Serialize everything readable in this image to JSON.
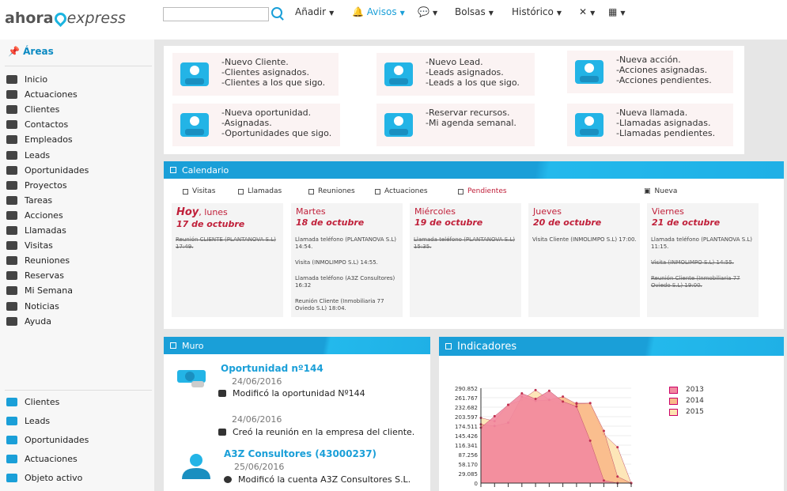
{
  "header": {
    "logo_a": "ahora",
    "logo_e": "express",
    "search_placeholder": "",
    "menu": [
      "Añadir",
      "Avisos",
      "",
      "Bolsas",
      "Histórico",
      "",
      ""
    ]
  },
  "sidebar": {
    "title": "Áreas",
    "items": [
      "Inicio",
      "Actuaciones",
      "Clientes",
      "Contactos",
      "Empleados",
      "Leads",
      "Oportunidades",
      "Proyectos",
      "Tareas",
      "Acciones",
      "Llamadas",
      "Visitas",
      "Reuniones",
      "Reservas",
      "Mi Semana",
      "Noticias",
      "Ayuda"
    ],
    "bottom": [
      "Clientes",
      "Leads",
      "Oportunidades",
      "Actuaciones",
      "Objeto activo"
    ]
  },
  "quick": [
    {
      "text": "-Nuevo Cliente.\n-Clientes asignados.\n-Clientes a los que sigo.",
      "icon": "user-icon"
    },
    {
      "text": "-Nuevo Lead.\n-Leads asignados.\n-Leads a los que sigo.",
      "icon": "lead-icon"
    },
    {
      "text": "-Nueva acción.\n-Acciones asignadas.\n-Acciones pendientes.",
      "icon": "clipboard-icon"
    },
    {
      "text": "-Nueva oportunidad.\n-Asignadas.\n-Oportunidades que sigo.",
      "icon": "money-icon"
    },
    {
      "text": "-Reservar recursos.\n-Mi agenda semanal.",
      "icon": "calendar-icon"
    },
    {
      "text": "-Nueva llamada.\n-Llamadas asignadas.\n-Llamadas pendientes.",
      "icon": "phone-icon"
    }
  ],
  "calendar": {
    "title": "Calendario",
    "filters": [
      "Visitas",
      "Llamadas",
      "Reuniones",
      "Actuaciones",
      "Pendientes"
    ],
    "new_label": "Nueva",
    "days": [
      {
        "name": "Hoy",
        "name2": ", lunes",
        "date": "17 de octubre",
        "events": [
          {
            "t": "Reunión CLIENTE (PLANTANOVA S.L) 17:49.",
            "s": true
          }
        ]
      },
      {
        "name": "Martes",
        "name2": "",
        "date": "18 de octubre",
        "events": [
          {
            "t": "Llamada teléfono (PLANTANOVA S.L) 14:54.",
            "s": false
          },
          {
            "t": "Visita (INMOLIMPO S.L) 14:55.",
            "s": false
          },
          {
            "t": "Llamada teléfono (A3Z Consultores) 16:32",
            "s": false
          },
          {
            "t": "Reunión Cliente (Inmobiliaria 77 Oviedo S.L) 18:04.",
            "s": false
          }
        ]
      },
      {
        "name": "Miércoles",
        "name2": "",
        "date": "19 de octubre",
        "events": [
          {
            "t": "Llamada teléfono (PLANTANOVA S.L) 15:35.",
            "s": true
          }
        ]
      },
      {
        "name": "Jueves",
        "name2": "",
        "date": "20 de octubre",
        "events": [
          {
            "t": "Visita Cliente (INMOLIMPO S.L) 17:00.",
            "s": false
          }
        ]
      },
      {
        "name": "Viernes",
        "name2": "",
        "date": "21 de octubre",
        "events": [
          {
            "t": "Llamada teléfono (PLANTANOVA S.L) 11:15.",
            "s": false
          },
          {
            "t": "Visita (INMOLIMPO S.L) 14:55.",
            "s": true
          },
          {
            "t": "Reunión Cliente (Inmobiliaria 77 Oviedo S.L) 19:00.",
            "s": true
          }
        ]
      }
    ]
  },
  "muro": {
    "title": "Muro",
    "posts": [
      {
        "title": "Oportunidad nº144",
        "date": "24/06/2016",
        "text": "Modificó la oportunidad Nº144"
      },
      {
        "title": "",
        "date": "24/06/2016",
        "text": "Creó la reunión en la empresa del cliente."
      },
      {
        "title": "A3Z Consultores (43000237)",
        "date": "25/06/2016",
        "text": "Modificó la cuenta A3Z Consultores S.L."
      }
    ]
  },
  "indicadores": {
    "title": "Indicadores"
  },
  "chart_data": {
    "type": "area",
    "y_ticks": [
      "290.852",
      "261.767",
      "232.682",
      "203.597",
      "174.511",
      "145.426",
      "116.341",
      "87.256",
      "58.170",
      "29.085",
      "0"
    ],
    "ylim": [
      0,
      290852
    ],
    "series": [
      {
        "name": "2013",
        "color": "#f28aa0",
        "values": [
          170000,
          205000,
          240000,
          275000,
          258000,
          283000,
          250000,
          235000,
          130000,
          8000,
          0,
          0
        ]
      },
      {
        "name": "2014",
        "color": "#f9b98a",
        "values": [
          180000,
          175000,
          185000,
          265000,
          252000,
          255000,
          265000,
          243000,
          245000,
          160000,
          20000,
          0
        ]
      },
      {
        "name": "2015",
        "color": "#fde3b0",
        "values": [
          200000,
          190000,
          240000,
          255000,
          285000,
          255000,
          240000,
          245000,
          245000,
          150000,
          110000,
          0
        ]
      }
    ]
  }
}
